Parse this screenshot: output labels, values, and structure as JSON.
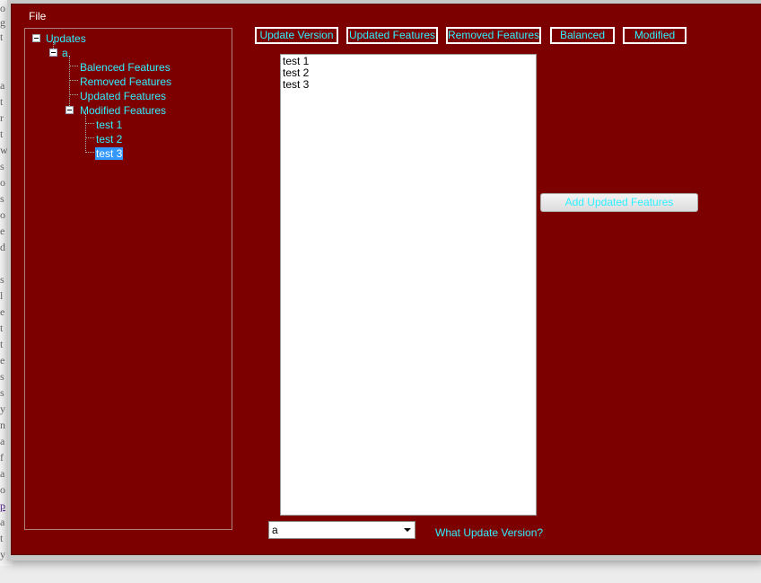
{
  "menu": {
    "file_label": "File"
  },
  "tree": {
    "root_label": "Updates",
    "version_label": "a",
    "children": [
      "Balenced Features",
      "Removed Features",
      "Updated Features",
      "Modified Features"
    ],
    "modified_children": [
      "test 1",
      "test 2",
      "test 3"
    ],
    "selected": "test 3"
  },
  "toolbar": {
    "update_version": "Update Version",
    "updated_features": "Updated Features",
    "removed_features": "Removed Features",
    "balanced": "Balanced",
    "modified": "Modified"
  },
  "feature_list": {
    "items": [
      "test 1",
      "test 2",
      "test 3"
    ]
  },
  "add_button_label": "Add Updated Features",
  "version_combo": {
    "value": "a"
  },
  "question_label": "What Update Version?",
  "colors": {
    "background": "#7d0000",
    "text_accent": "#2ef0ff",
    "selection": "#3399ff"
  }
}
